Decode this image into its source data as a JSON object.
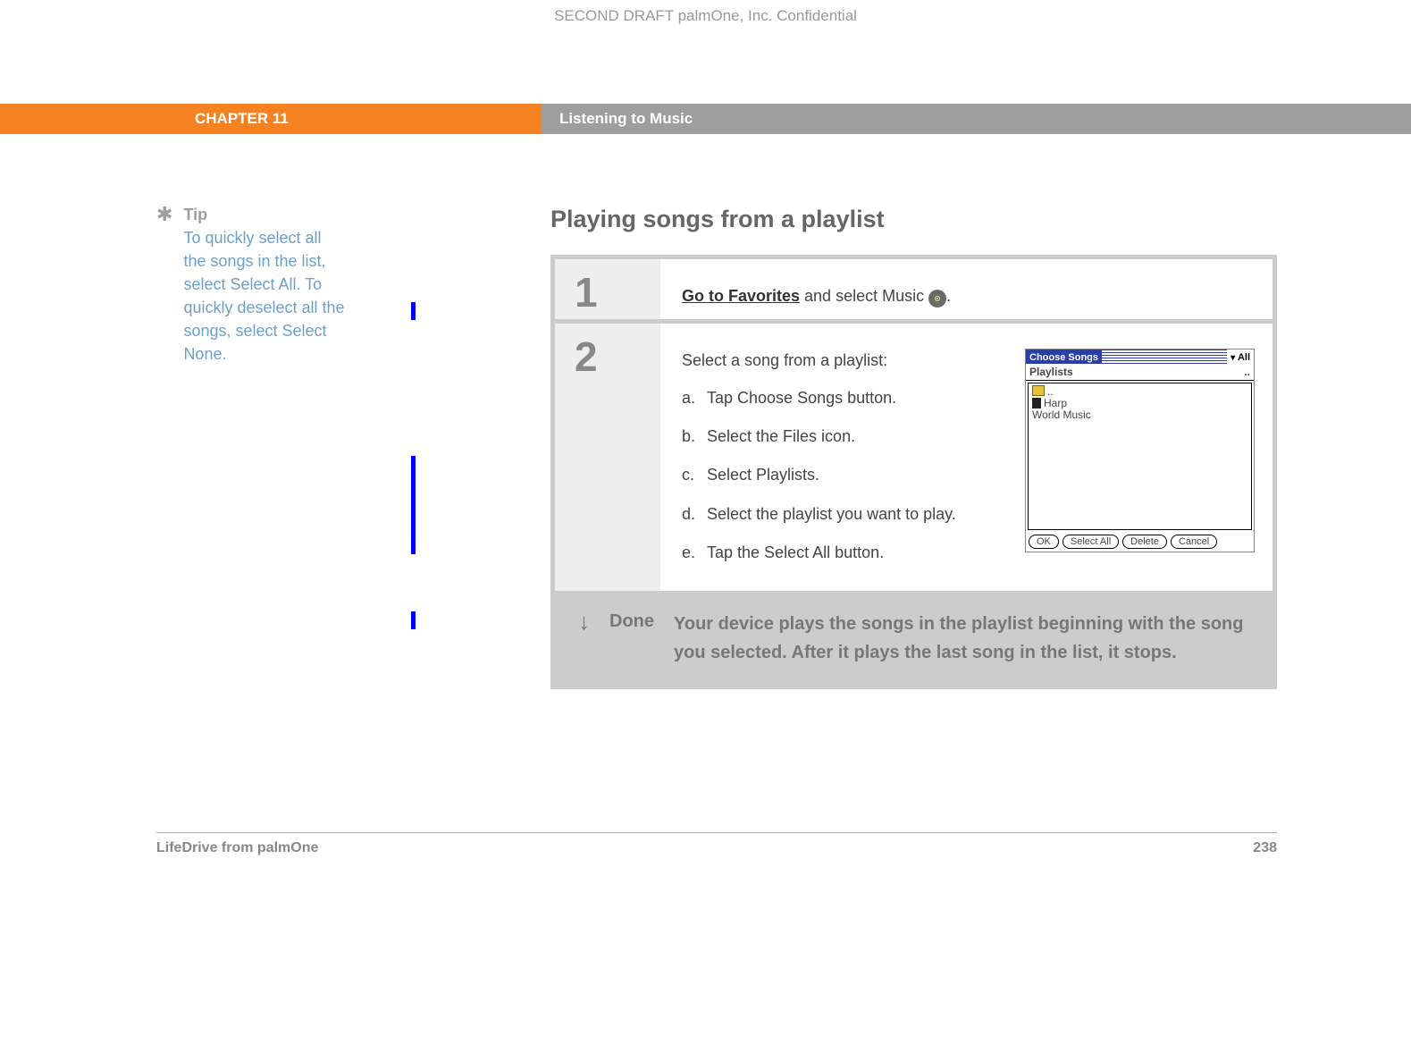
{
  "draft_line": "SECOND DRAFT palmOne, Inc.  Confidential",
  "chapter_label": "CHAPTER 11",
  "chapter_title": "Listening to Music",
  "tip": {
    "label": "Tip",
    "text": "To quickly select all the songs in the list, select Select All. To quickly deselect all the songs, select Select None."
  },
  "section_heading": "Playing songs from a playlist",
  "step1": {
    "num": "1",
    "link_text": "Go to Favorites",
    "after_link": " and select Music ",
    "period": "."
  },
  "step2": {
    "num": "2",
    "intro": "Select a song from a playlist:",
    "items": [
      {
        "letter": "a.",
        "text": "Tap Choose Songs button."
      },
      {
        "letter": "b.",
        "text": "Select the Files icon."
      },
      {
        "letter": "c.",
        "text": "Select Playlists."
      },
      {
        "letter": "d.",
        "text": "Select the playlist you want to play."
      },
      {
        "letter": "e.",
        "text": "Tap the Select All button."
      }
    ]
  },
  "screenshot": {
    "title": "Choose Songs",
    "filter": "All",
    "subhead": "Playlists",
    "rows": [
      "..",
      "Harp",
      "World Music"
    ],
    "btn_ok": "OK",
    "btn_selectall": "Select All",
    "btn_delete": "Delete",
    "btn_cancel": "Cancel"
  },
  "done": {
    "label": "Done",
    "text": "Your device plays the songs in the playlist beginning with the song you selected. After it plays the last song in the list, it stops."
  },
  "footer_left": "LifeDrive from palmOne",
  "footer_right": "238"
}
